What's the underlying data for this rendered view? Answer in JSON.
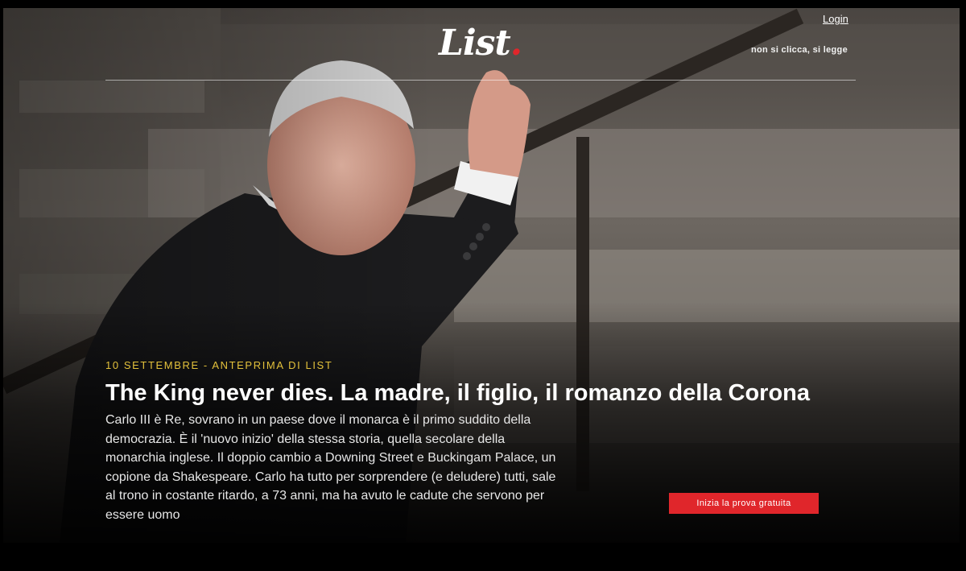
{
  "header": {
    "logo_text": "List",
    "logo_dot": ".",
    "login_label": "Login",
    "tagline": "non si clicca, si legge"
  },
  "article": {
    "kicker": "10 SETTEMBRE - ANTEPRIMA DI LIST",
    "headline": "The King never dies. La madre, il figlio, il romanzo della Corona",
    "summary": "Carlo III è Re, sovrano in un paese dove il monarca è il primo suddito della democrazia. È il 'nuovo inizio' della stessa storia, quella secolare della monarchia inglese. Il doppio cambio a Downing Street e Buckingam Palace, un copione da Shakespeare. Carlo ha tutto per sorprendere (e deludere) tutti, sale al trono in costante ritardo, a 73 anni, ma ha avuto le cadute che servono per essere uomo"
  },
  "cta": {
    "label": "Inizia la prova gratuita"
  },
  "colors": {
    "accent": "#e0262b",
    "kicker": "#e3c13b",
    "page_background": "#000000"
  },
  "hero_image": {
    "icon": "photo-king-waving"
  }
}
